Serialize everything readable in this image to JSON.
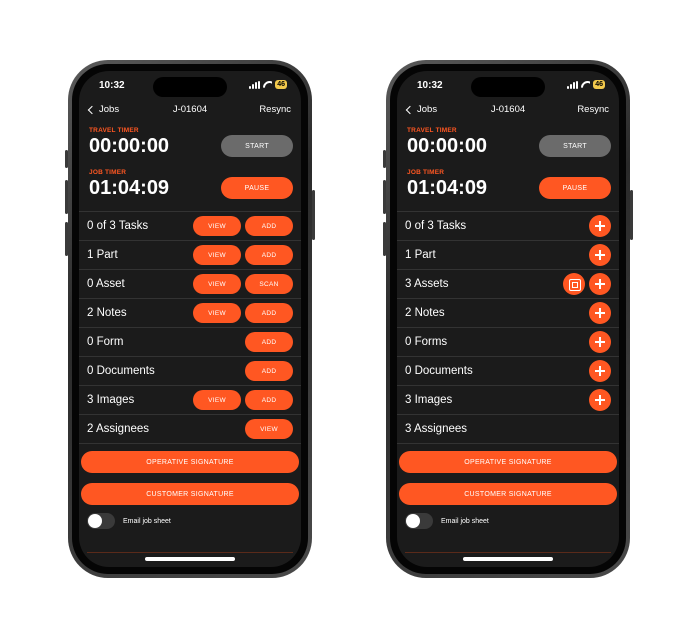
{
  "status": {
    "time": "10:32",
    "battery": "46"
  },
  "nav": {
    "back_label": "Jobs",
    "title": "J-01604",
    "resync_label": "Resync"
  },
  "timers": {
    "travel_label": "TRAVEL TIMER",
    "travel_value": "00:00:00",
    "start_label": "START",
    "job_label": "JOB TIMER",
    "job_value": "01:04:09",
    "pause_label": "PAUSE"
  },
  "left_rows": [
    {
      "label": "0 of 3 Tasks",
      "buttons": [
        "VIEW",
        "ADD"
      ]
    },
    {
      "label": "1 Part",
      "buttons": [
        "VIEW",
        "ADD"
      ]
    },
    {
      "label": "0 Asset",
      "buttons": [
        "VIEW",
        "SCAN"
      ]
    },
    {
      "label": "2 Notes",
      "buttons": [
        "VIEW",
        "ADD"
      ]
    },
    {
      "label": "0 Form",
      "buttons": [
        "ADD"
      ]
    },
    {
      "label": "0 Documents",
      "buttons": [
        "ADD"
      ]
    },
    {
      "label": "3 Images",
      "buttons": [
        "VIEW",
        "ADD"
      ]
    },
    {
      "label": "2 Assignees",
      "buttons": [
        "VIEW"
      ]
    }
  ],
  "right_rows": [
    {
      "label": "0 of 3 Tasks",
      "icons": [
        "plus-icon"
      ]
    },
    {
      "label": "1 Part",
      "icons": [
        "plus-icon"
      ]
    },
    {
      "label": "3 Assets",
      "icons": [
        "scan-icon",
        "plus-icon"
      ]
    },
    {
      "label": "2 Notes",
      "icons": [
        "plus-icon"
      ]
    },
    {
      "label": "0 Forms",
      "icons": [
        "plus-icon"
      ]
    },
    {
      "label": "0 Documents",
      "icons": [
        "plus-icon"
      ]
    },
    {
      "label": "3 Images",
      "icons": [
        "plus-icon"
      ]
    },
    {
      "label": "3 Assignees",
      "icons": []
    }
  ],
  "signatures": {
    "operative": "OPERATIVE SIGNATURE",
    "customer": "CUSTOMER SIGNATURE"
  },
  "email": {
    "label": "Email job sheet",
    "enabled": false
  },
  "colors": {
    "accent": "#ff5722",
    "background": "#1b1b1b",
    "muted_button": "#6b6b6b"
  }
}
